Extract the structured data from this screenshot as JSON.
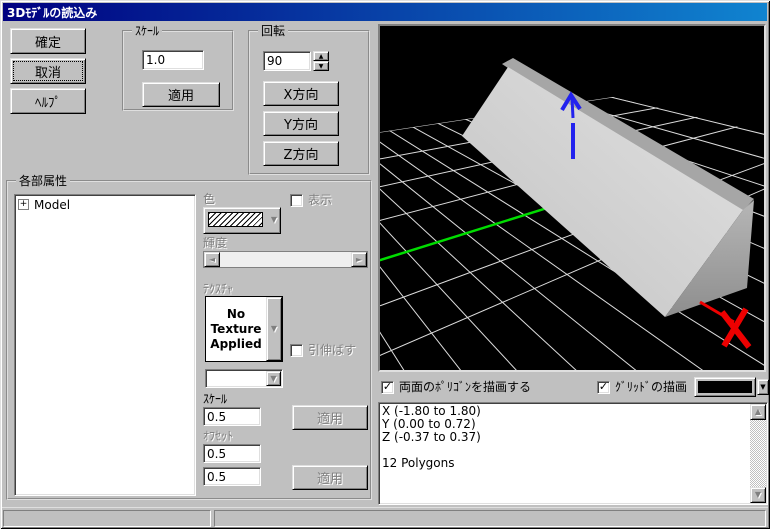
{
  "window": {
    "title": "3Dﾓﾃﾞﾙの読込み"
  },
  "buttons": {
    "ok": "確定",
    "cancel": "取消",
    "help": "ﾍﾙﾌﾟ"
  },
  "scale_group": {
    "title": "ｽｹｰﾙ",
    "input_value": "1.0",
    "apply_label": "適用"
  },
  "rotation_group": {
    "title": "回転",
    "angle_value": "90",
    "x_label": "X方向",
    "y_label": "Y方向",
    "z_label": "Z方向"
  },
  "attributes_group": {
    "title": "各部属性",
    "tree_root_label": "Model",
    "color_label": "色",
    "visible_label": "表示",
    "visible_checked": false,
    "brightness_label": "輝度",
    "texture_label": "ﾃｸｽﾁｬ",
    "texture_value": "No Texture Applied",
    "stretch_label": "引伸ばす",
    "stretch_checked": false,
    "tex_scale_label": "ｽｹｰﾙ",
    "tex_scale_value": "0.5",
    "apply_scale_label": "適用",
    "offset_label": "ｵﾌｾｯﾄ",
    "offset_value_1": "0.5",
    "offset_value_2": "0.5",
    "apply_offset_label": "適用"
  },
  "viewport": {
    "both_faces_label": "両面のﾎﾟﾘｺﾞﾝを描画する",
    "both_faces_checked": true,
    "grid_label": "ｸﾞﾘｯﾄﾞの描画",
    "grid_checked": true,
    "grid_color_value": "#000000",
    "info_text": "X (-1.80 to 1.80)\nY (0.00 to 0.72)\nZ (-0.37 to 0.37)\n\n12 Polygons"
  },
  "colors": {
    "titlebar_left": "#000080",
    "titlebar_right": "#1084d0",
    "dialog_bg": "#c0c0c0",
    "viewport_bg": "#000000",
    "grid_line": "#dcdcdc",
    "axis_x_red": "#ee0000",
    "axis_y_blue": "#2222ee",
    "axis_z_green": "#00dd00"
  }
}
